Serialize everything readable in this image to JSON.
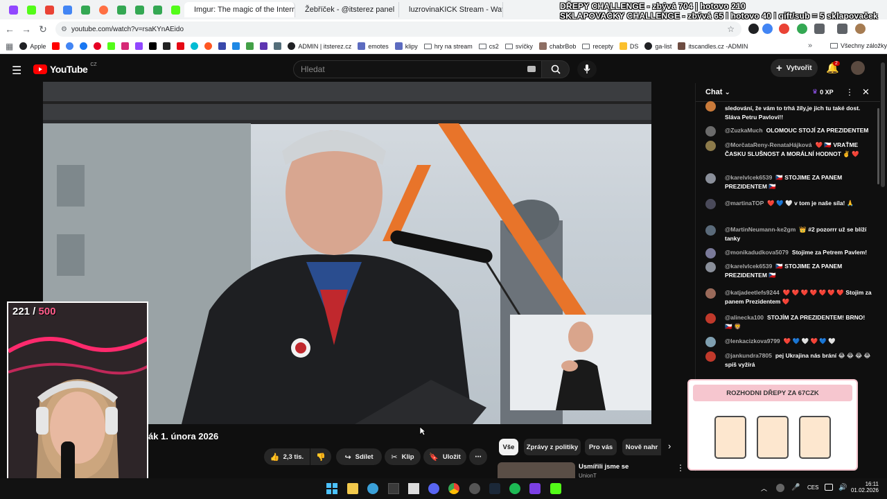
{
  "browser": {
    "tabs": [
      {
        "title": "Imgur: The magic of the Interne",
        "favicon": "imgur-icon"
      },
      {
        "title": "Žebříček - @itsterez panel",
        "favicon": "leaderboard-icon"
      },
      {
        "title": "luzrovinaKICK Stream - Watch l",
        "favicon": "kick-icon"
      }
    ],
    "url": "youtube.com/watch?v=rsaKYnAEido",
    "overlay_lines": [
      "DŘEPY CHALLENGE - zbývá 704 | hotovo 210",
      "SKLAPOVAČKY CHALLENGE - zbývá 65 | hotovo 40 | gift/sub = 5 sklapovaček"
    ],
    "bookmarks": [
      "Apple",
      "ADMIN | itsterez.cz",
      "emotes",
      "klipy",
      "hry na stream",
      "cs2",
      "svíčky",
      "chabrBob",
      "recepty",
      "DS",
      "ga-list",
      "itscandles.cz -ADMIN"
    ],
    "bookmarks_other": "Všechny záložky"
  },
  "youtube": {
    "logo_text": "YouTube",
    "logo_region": "CZ",
    "search_placeholder": "Hledat",
    "create_label": "Vytvořit",
    "notif_count": "2",
    "video_title_fragment": "ák 1. února 2026",
    "actions": {
      "like_count": "2,3 tis.",
      "share": "Sdílet",
      "clip": "Klip",
      "save": "Uložit"
    },
    "filters": [
      "Vše",
      "Zprávy z politiky",
      "Pro vás",
      "Nově nahr"
    ],
    "recommended": {
      "title": "Usmířili jsme se",
      "channel": "UnionT"
    }
  },
  "chat": {
    "header": "Chat",
    "xp": "0 XP",
    "messages": [
      {
        "author": "",
        "text": "sledování, že vám to trhá žíly,je jich tu také dost. Sláva Petru Pavlovi!!",
        "color": "#c97a3a"
      },
      {
        "author": "@ZuzkaMuch",
        "text": "OLOMOUC STOJÍ ZA PREZIDENTEM",
        "color": "#6b6b6b"
      },
      {
        "author": "@MorčataReny-RenataHájková",
        "text": "❤️ 🇨🇿 VRAŤME ČASKU SLUŠNOST A MORÁLNÍ HODNOT ✌️ ❤️",
        "color": "#8c7a4a"
      },
      {
        "author": "@karelvlcek6539",
        "text": "🇨🇿 STOJIME ZA PANEM PREZIDENTEM 🇨🇿",
        "color": "#8a8f9a"
      },
      {
        "author": "@martinaTOP",
        "text": "❤️ 💙 🤍 v tom je naše síla! 🙏",
        "color": "#4a4a5a"
      },
      {
        "author": "@MartinNeumann-ke2gm",
        "text": "👑 #2 pozorrr už se blíží tanky",
        "color": "#5a6a7a"
      },
      {
        "author": "@monikadudkova5079",
        "text": "Stojime za Petrem Pavlem!",
        "color": "#7a7a9a"
      },
      {
        "author": "@karelvlcek6539",
        "text": "🇨🇿 STOJIME ZA PANEM PREZIDENTEM 🇨🇿",
        "color": "#8a8f9a"
      },
      {
        "author": "@katjadeetlefs9244",
        "text": "❤️ ❤️ ❤️ ❤️ ❤️ ❤️ ❤️ Stojim za panem Prezidentem ❤️",
        "color": "#9a6a5a"
      },
      {
        "author": "@alinecka100",
        "text": "STOJÍM ZA PREZIDENTEM! BRNO! 🇨🇿 🦁",
        "color": "#c0392b"
      },
      {
        "author": "@lenkacizkova9799",
        "text": "❤️ 💙 🤍 ❤️ 💙 🤍",
        "color": "#7f9fb0"
      },
      {
        "author": "@jankundra7805",
        "text": "pej Ukrajina nás brání 😂 😂 😂 😂 spíš vyžírá",
        "color": "#c0392b"
      }
    ]
  },
  "webcam": {
    "count": "221",
    "total": "500",
    "separator": " / "
  },
  "popup": {
    "title": "ROZHODNI DŘEPY ZA 67CZK"
  },
  "taskbar": {
    "lang": "CES",
    "time": "16:11",
    "date": "01.02.2026"
  },
  "colors": {
    "accent": "#ff0000",
    "kick": "#53fc18",
    "popup_pink": "#f6c6cf",
    "card": "#fde7cf"
  }
}
